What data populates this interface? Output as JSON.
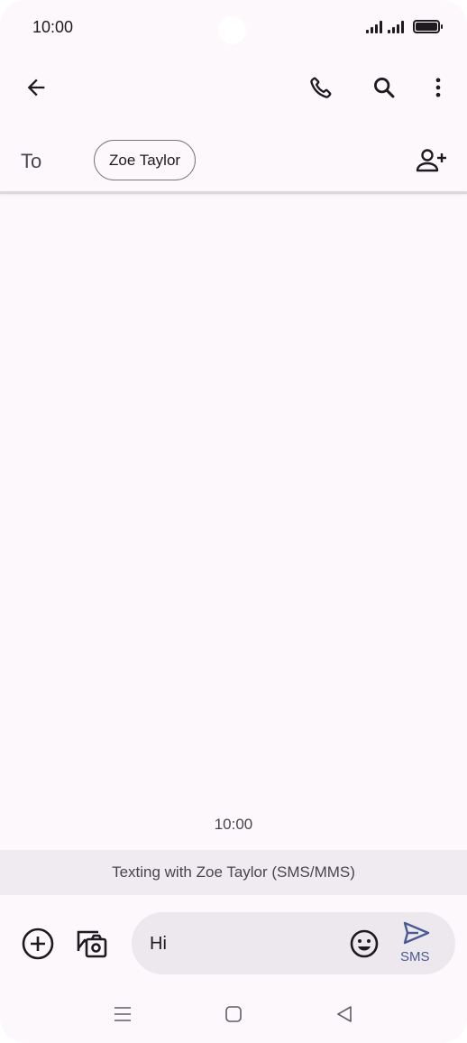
{
  "status_bar": {
    "time": "10:00",
    "icons": [
      "signal-icon",
      "signal-icon",
      "battery-icon"
    ]
  },
  "app_bar": {
    "icons": [
      "back-arrow-icon",
      "phone-icon",
      "search-icon",
      "more-vert-icon"
    ]
  },
  "recipient": {
    "to_label": "To",
    "chip_name": "Zoe Taylor",
    "add_icon": "add-person-icon"
  },
  "conversation": {
    "timestamp": "10:00",
    "texting_info": "Texting with Zoe Taylor (SMS/MMS)"
  },
  "compose": {
    "value": "Hi",
    "icons": [
      "add-circle-icon",
      "gallery-icon",
      "emoji-icon",
      "send-icon"
    ],
    "send_label": "SMS"
  },
  "nav_bar": {
    "icons": [
      "menu-icon",
      "home-icon",
      "back-icon"
    ]
  },
  "colors": {
    "background": "#fcf8fc",
    "compose_field": "#ece8ed",
    "banner": "#efebf0",
    "send_accent": "#4a5a92"
  }
}
